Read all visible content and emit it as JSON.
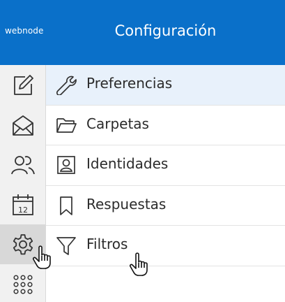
{
  "header": {
    "logo_text": "webnode",
    "title": "Configuración"
  },
  "rail": {
    "items": [
      {
        "icon": "compose-icon"
      },
      {
        "icon": "mail-icon"
      },
      {
        "icon": "contacts-icon"
      },
      {
        "icon": "calendar-icon",
        "calendar_day": "12"
      },
      {
        "icon": "settings-icon",
        "active": true
      },
      {
        "icon": "apps-icon"
      }
    ]
  },
  "menu": {
    "items": [
      {
        "label": "Preferencias",
        "icon": "wrench-icon",
        "selected": true
      },
      {
        "label": "Carpetas",
        "icon": "folder-icon"
      },
      {
        "label": "Identidades",
        "icon": "identity-card-icon"
      },
      {
        "label": "Respuestas",
        "icon": "bookmark-icon"
      },
      {
        "label": "Filtros",
        "icon": "filter-icon"
      }
    ]
  },
  "colors": {
    "header_bg": "#0a70c9",
    "selected_bg": "#e8f1fb",
    "rail_bg": "#f1f1f1"
  }
}
